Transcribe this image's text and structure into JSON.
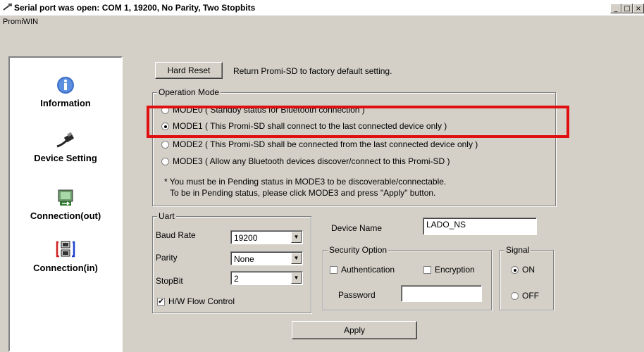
{
  "window": {
    "title": "Serial port was open: COM 1, 19200, No Parity, Two Stopbits",
    "menu": "PromiWIN",
    "controls": [
      "_",
      "□",
      "×"
    ]
  },
  "sidebar": {
    "items": [
      {
        "label": "Information",
        "icon": "info-icon"
      },
      {
        "label": "Device Setting",
        "icon": "serial-cable-icon"
      },
      {
        "label": "Connection(out)",
        "icon": "connection-out-icon"
      },
      {
        "label": "Connection(in)",
        "icon": "connection-in-icon"
      }
    ],
    "selected": "Device Setting"
  },
  "hard_reset": {
    "button_label": "Hard Reset",
    "description": "Return Promi-SD to factory default setting."
  },
  "operation_mode": {
    "legend": "Operation Mode",
    "modes": [
      {
        "label": "MODE0 ( Standby status for Bluetooth connection )",
        "selected": false
      },
      {
        "label": "MODE1 ( This Promi-SD shall connect to the last connected device only )",
        "selected": true
      },
      {
        "label": "MODE2 ( This Promi-SD shall be connected from the last connected device only )",
        "selected": false
      },
      {
        "label": "MODE3 ( Allow any Bluetooth devices discover/connect to this Promi-SD )",
        "selected": false
      }
    ],
    "note_line1": "* You must be in Pending status in MODE3 to be discoverable/connectable.",
    "note_line2": "To be in Pending status, please click MODE3 and press \"Apply\" button."
  },
  "uart": {
    "legend": "Uart",
    "baud_rate_label": "Baud Rate",
    "baud_rate_value": "19200",
    "parity_label": "Parity",
    "parity_value": "None",
    "stopbit_label": "StopBit",
    "stopbit_value": "2",
    "flow_control_label": "H/W Flow Control",
    "flow_control_checked": true
  },
  "device": {
    "name_label": "Device Name",
    "name_value": "LADO_NS"
  },
  "security": {
    "legend": "Security Option",
    "authentication_label": "Authentication",
    "authentication_checked": false,
    "encryption_label": "Encryption",
    "encryption_checked": false,
    "password_label": "Password",
    "password_value": ""
  },
  "signal": {
    "legend": "Signal",
    "on_label": "ON",
    "off_label": "OFF",
    "selected": "ON"
  },
  "apply_label": "Apply",
  "colors": {
    "highlight": "#e01010",
    "window_bg": "#d4d0c8"
  }
}
